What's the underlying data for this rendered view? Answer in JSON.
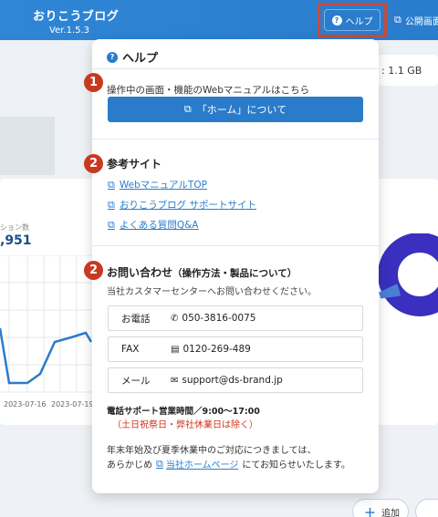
{
  "app": {
    "name": "おりこうブログ",
    "version": "Ver.1.5.3"
  },
  "header": {
    "help_label": "ヘルプ",
    "public_label": "公開画面"
  },
  "storage": {
    "value": ": 1.1 GB"
  },
  "chart_area": {
    "session_label": "ション数",
    "session_value": ",951"
  },
  "chart_data": {
    "type": "line",
    "x": [
      "2023-07-16",
      "2023-07-19"
    ],
    "values": [],
    "color": "#2a7ccc"
  },
  "help": {
    "title": "ヘルプ",
    "badges": [
      "1",
      "2",
      "2"
    ],
    "manual_text": "操作中の画面・機能のWebマニュアルはこちら",
    "manual_button": "「ホーム」について",
    "ref_title": "参考サイト",
    "links": [
      "WebマニュアルTOP",
      "おりこうブログ サポートサイト",
      "よくある質問Q&A"
    ],
    "contact_title": "お問い合わせ",
    "contact_sub": "（操作方法・製品について）",
    "contact_intro": "当社カスタマーセンターへお問い合わせください。",
    "phone_label": "お電話",
    "phone_value": "050-3816-0075",
    "fax_label": "FAX",
    "fax_value": "0120-269-489",
    "mail_label": "メール",
    "mail_value": "support@ds-brand.jp",
    "hours": "電話サポート営業時間／9:00～17:00",
    "hours_note": "（土日祝祭日・弊社休業日は除く）",
    "holiday_line1": "年末年始及び夏季休業中のご対応につきましては、",
    "holiday_pre": "あらかじめ",
    "holiday_link": "当社ホームページ",
    "holiday_post": "にてお知らせいたします。"
  },
  "footer": {
    "add_label": "追加"
  }
}
